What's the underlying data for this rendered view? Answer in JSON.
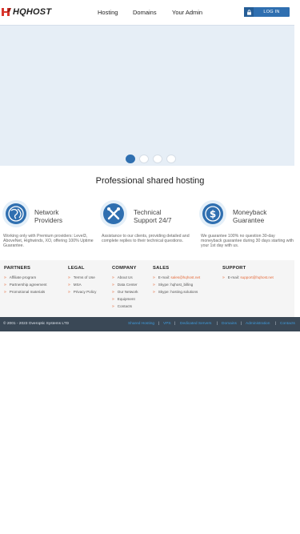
{
  "header": {
    "logo_text": "HQHOST",
    "nav": [
      "Hosting",
      "Domains",
      "Your Admin"
    ],
    "login_label": "LOG IN",
    "brand_color": "#2f6fb0",
    "logo_color": "#d9352c"
  },
  "hero": {
    "slides": 4,
    "active_slide": 1
  },
  "section_title": "Professional shared hosting",
  "features": [
    {
      "icon": "globe-icon",
      "title_1": "Network",
      "title_2": "Providers",
      "desc": "Working only with Premium providers: Level3, AboveNet, Highwinds, XO, offering 100% Uptime Guarantee."
    },
    {
      "icon": "tools-icon",
      "title_1": "Technical",
      "title_2": "Support 24/7",
      "desc": "Assistance to our clients, providing detailed and complete replies to their technical questions."
    },
    {
      "icon": "dollar-icon",
      "title_1": "Moneyback",
      "title_2": "Guarantee",
      "desc": "We guarantee 100% no question 30-day moneyback guarantee during 30 days starting with your 1st day with us."
    }
  ],
  "footer": {
    "columns": [
      {
        "heading": "PARTNERS",
        "links": [
          "Affiliate program",
          "Partnership agreement",
          "Promotional materials"
        ]
      },
      {
        "heading": "LEGAL",
        "links": [
          "Terms of Use",
          "MSA",
          "Privacy Policy"
        ]
      },
      {
        "heading": "COMPANY",
        "links": [
          "About Us",
          "Data Center",
          "Our Network",
          "Equipment",
          "Contacts"
        ]
      },
      {
        "heading": "SALES",
        "links": [
          {
            "prefix": "E-mail: ",
            "value": "sales@hqhost.net"
          },
          {
            "prefix": "Skype: ",
            "value": "hqhost_billing"
          },
          {
            "prefix": "Skype: ",
            "value": "hosting.solutions"
          }
        ]
      },
      {
        "heading": "SUPPORT",
        "links": [
          {
            "prefix": "E-mail: ",
            "value": "support@hqhost.net"
          }
        ]
      }
    ],
    "accent_color": "#e46a3a"
  },
  "bottom_bar": {
    "copyright": "© 2001 - 2023 Overoptic Systems LTD",
    "links": [
      "Shared Hosting",
      "VPS",
      "Dedicated Servers",
      "Domains",
      "Administration",
      "Contacts"
    ],
    "link_color": "#3f9bdc"
  }
}
